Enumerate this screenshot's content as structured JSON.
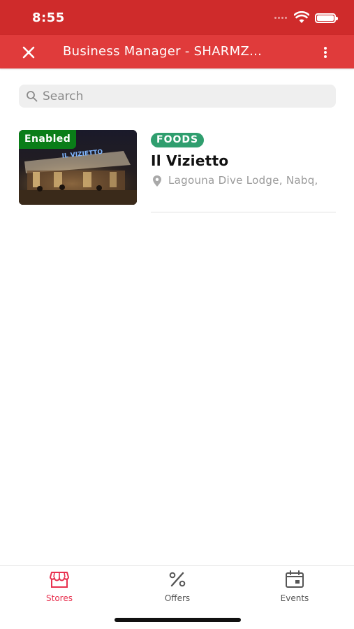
{
  "status_bar": {
    "time": "8:55"
  },
  "app_bar": {
    "title": "Business Manager - SHARMZ...",
    "close_icon": "close-icon",
    "menu_icon": "more-vertical-icon"
  },
  "search": {
    "placeholder": "Search",
    "value": ""
  },
  "stores": [
    {
      "status": "Enabled",
      "category": "FOODS",
      "name": "Il Vizietto",
      "address": "Lagouna Dive Lodge, Nabq,",
      "sign_text": "IL VIZIETTO"
    }
  ],
  "tabs": [
    {
      "label": "Stores",
      "icon": "store-icon",
      "active": true
    },
    {
      "label": "Offers",
      "icon": "percent-icon",
      "active": false
    },
    {
      "label": "Events",
      "icon": "calendar-icon",
      "active": false
    }
  ],
  "colors": {
    "status_bar": "#cf2b2b",
    "app_bar": "#e03b3b",
    "accent": "#e8314f",
    "enabled_badge": "#0a7d18",
    "category_chip": "#2f9e6e",
    "inactive_tab": "#555555"
  }
}
